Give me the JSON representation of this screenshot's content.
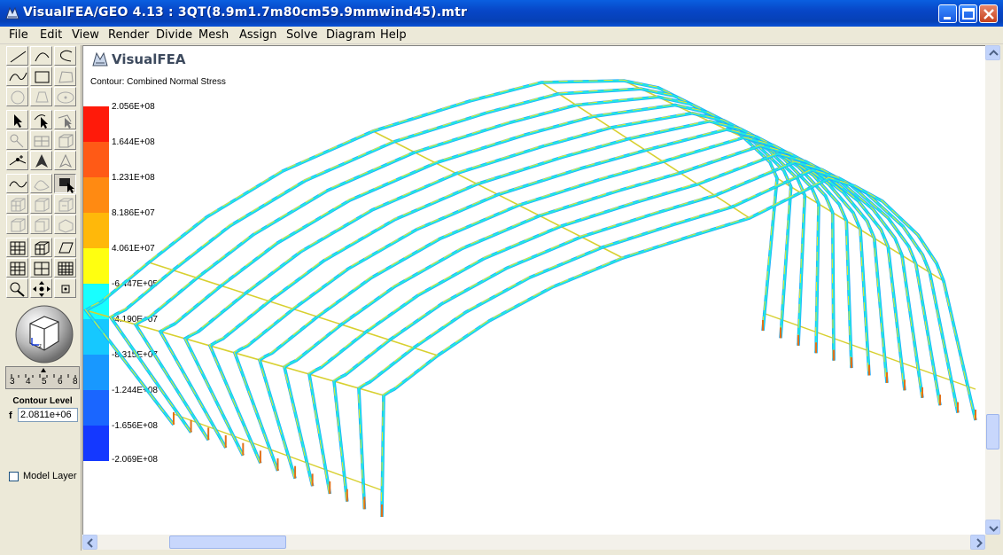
{
  "window": {
    "title": "VisualFEA/GEO 4.13 :  3QT(8.9m1.7m80cm59.9mmwind45).mtr"
  },
  "menu": [
    "File",
    "Edit",
    "View",
    "Render",
    "Divide",
    "Mesh",
    "Assign",
    "Solve",
    "Diagram",
    "Help"
  ],
  "sidebar": {
    "ruler_numbers": [
      "3",
      "4",
      "5",
      "6",
      "8"
    ],
    "contour_level_title": "Contour Level",
    "contour_field_label": "f",
    "contour_value": "2.0811e+06",
    "model_layer_label": "Model Layer",
    "model_layer_checked": false
  },
  "viewport": {
    "logo_text": "VisualFEA",
    "contour_label": "Contour: Combined Normal Stress",
    "legend": {
      "values": [
        "2.056E+08",
        "1.644E+08",
        "1.231E+08",
        "8.186E+07",
        "4.061E+07",
        "-6.447E+05",
        "-4.190E+07",
        "-8.315E+07",
        "-1.244E+08",
        "-1.656E+08",
        "-2.069E+08"
      ],
      "colors": [
        "#ff1a0a",
        "#ff5a16",
        "#ff8a12",
        "#ffb80a",
        "#ffff10",
        "#18ffff",
        "#16c8ff",
        "#1898ff",
        "#1a66ff",
        "#1438ff",
        "#0a10f0"
      ]
    }
  },
  "icons": {
    "app": "visualfea-logo-icon",
    "minimize": "minimize-icon",
    "maximize": "maximize-icon",
    "close": "close-icon"
  }
}
